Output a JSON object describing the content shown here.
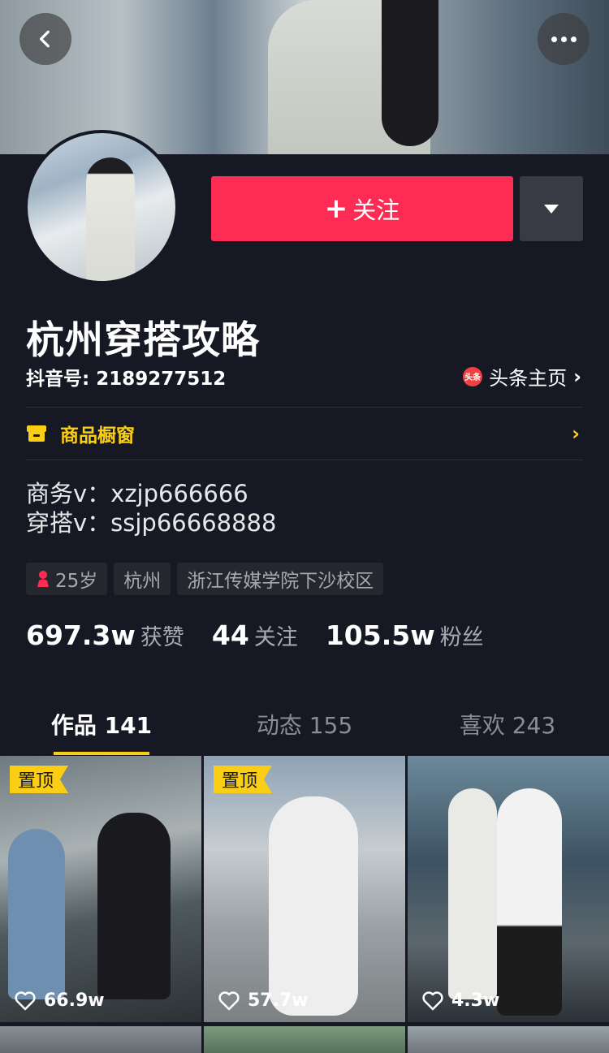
{
  "header": {
    "back_icon": "back-arrow-icon",
    "more_icon": "more-dots-icon"
  },
  "profile": {
    "follow_label": "关注",
    "follow_plus": "+",
    "name": "杭州穿搭攻略",
    "douyin_id": "抖音号: 2189277512",
    "toutiao_badge": "头条",
    "toutiao_label": "头条主页",
    "toutiao_chevron": "›",
    "shop_label": "商品橱窗",
    "shop_chevron": "›",
    "bio_line1": "商务v：xzjp666666",
    "bio_line2": "穿搭v：ssjp66668888",
    "tags": {
      "age": "25岁",
      "city": "杭州",
      "school": "浙江传媒学院下沙校区"
    },
    "stats": {
      "likes_num": "697.3w",
      "likes_label": "获赞",
      "following_num": "44",
      "following_label": "关注",
      "fans_num": "105.5w",
      "fans_label": "粉丝"
    }
  },
  "tabs": [
    {
      "label": "作品 141"
    },
    {
      "label": "动态 155"
    },
    {
      "label": "喜欢 243"
    }
  ],
  "videos": [
    {
      "pinned": "置顶",
      "likes": "66.9w"
    },
    {
      "pinned": "置顶",
      "likes": "57.7w"
    },
    {
      "pinned": "",
      "likes": "4.3w"
    }
  ],
  "colors": {
    "background": "#161823",
    "follow": "#fe2c55",
    "accent": "#face15"
  }
}
